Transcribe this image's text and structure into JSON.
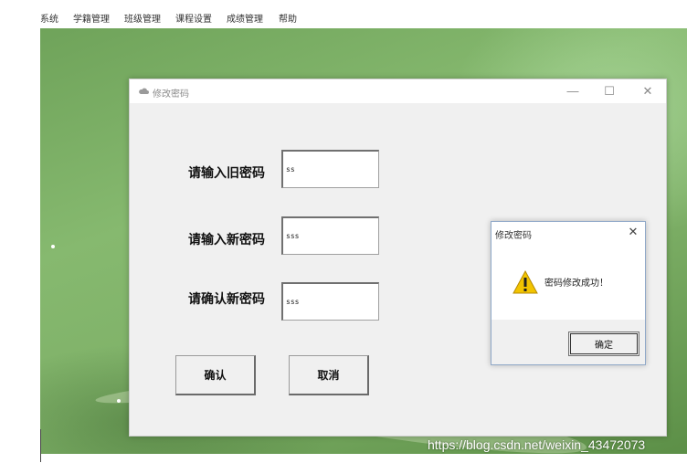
{
  "menubar": {
    "items": [
      {
        "label": "系统"
      },
      {
        "label": "学籍管理"
      },
      {
        "label": "班级管理"
      },
      {
        "label": "课程设置"
      },
      {
        "label": "成绩管理"
      },
      {
        "label": "帮助"
      }
    ]
  },
  "main_window": {
    "title": "修改密码",
    "icon": "cloud-icon",
    "controls": {
      "minimize": "—",
      "maximize": "☐",
      "close": "✕"
    },
    "fields": [
      {
        "label": "请输入旧密码",
        "value": "ss"
      },
      {
        "label": "请输入新密码",
        "value": "sss"
      },
      {
        "label": "请确认新密码",
        "value": "sss"
      }
    ],
    "confirm_label": "确认",
    "cancel_label": "取消"
  },
  "message_box": {
    "title": "修改密码",
    "close": "✕",
    "icon": "warning-icon",
    "message": "密码修改成功！",
    "ok_label": "确定"
  },
  "watermark": "https://blog.csdn.net/weixin_43472073",
  "colors": {
    "desktop": "#7fb168",
    "window_bg": "#f0f0f0",
    "dialog_border": "#8fa8c8"
  }
}
